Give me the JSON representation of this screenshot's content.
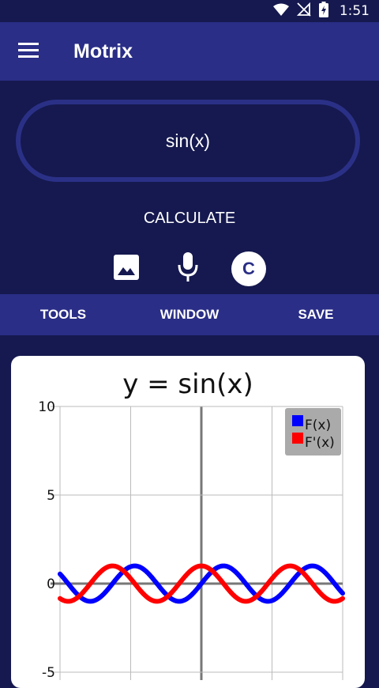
{
  "status_bar": {
    "time": "1:51"
  },
  "app_bar": {
    "title": "Motrix"
  },
  "expression": {
    "value": "sin(x)"
  },
  "calculate_label": "CALCULATE",
  "clear_label": "C",
  "tools": {
    "tab1": "TOOLS",
    "tab2": "WINDOW",
    "tab3": "SAVE"
  },
  "graph": {
    "title": "y = sin(x)",
    "legend": [
      "F(x)",
      "F'(x)"
    ]
  },
  "chart_data": {
    "type": "line",
    "title": "y = sin(x)",
    "xlim": [
      -10,
      10
    ],
    "ylim": [
      -5,
      10
    ],
    "yticks": [
      "10",
      "5",
      "0",
      "-5"
    ],
    "series": [
      {
        "name": "F(x)",
        "color": "#0000ff",
        "function": "sin(x)"
      },
      {
        "name": "F'(x)",
        "color": "#ff0000",
        "function": "cos(x)"
      }
    ],
    "grid": true,
    "legend_position": "top-right"
  }
}
